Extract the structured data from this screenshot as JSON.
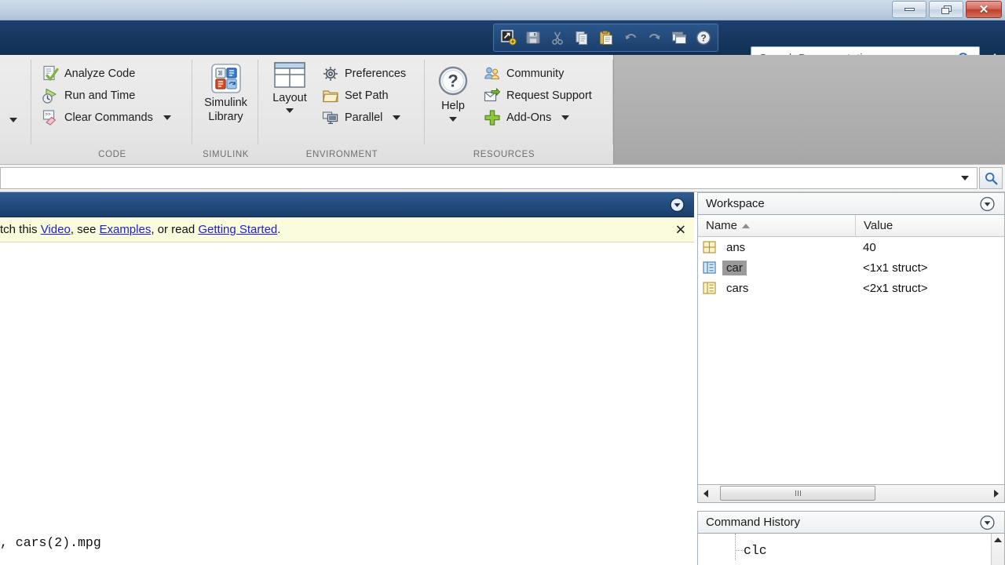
{
  "window": {
    "controls": [
      {
        "name": "minimize",
        "glyph": "minimize-icon"
      },
      {
        "name": "restore",
        "glyph": "restore-icon"
      },
      {
        "name": "close",
        "glyph": "close-icon",
        "label": "✕",
        "color": "#bf3f2c"
      }
    ]
  },
  "quick_access": {
    "buttons": [
      {
        "name": "new-script-icon",
        "tooltip": "New Script"
      },
      {
        "name": "save-icon",
        "tooltip": "Save"
      },
      {
        "name": "cut-icon",
        "tooltip": "Cut"
      },
      {
        "name": "copy-icon",
        "tooltip": "Copy"
      },
      {
        "name": "paste-icon",
        "tooltip": "Paste"
      },
      {
        "name": "undo-icon",
        "tooltip": "Undo"
      },
      {
        "name": "redo-icon",
        "tooltip": "Redo"
      },
      {
        "name": "switch-windows-icon",
        "tooltip": "Switch Windows"
      },
      {
        "name": "help-icon",
        "tooltip": "Help"
      }
    ]
  },
  "search": {
    "placeholder": "Search Documentation",
    "icon": "magnifier-icon"
  },
  "ribbon": {
    "groups": [
      {
        "title": "CODE",
        "items": [
          {
            "label": "Analyze Code",
            "icon": "analyze-code-icon",
            "has_dropdown": false
          },
          {
            "label": "Run and Time",
            "icon": "run-and-time-icon",
            "has_dropdown": false
          },
          {
            "label": "Clear Commands",
            "icon": "clear-commands-icon",
            "has_dropdown": true
          }
        ]
      },
      {
        "title": "SIMULINK",
        "items": [
          {
            "label": "Simulink\nLibrary",
            "label_line1": "Simulink",
            "label_line2": "Library",
            "icon": "simulink-library-icon",
            "has_dropdown": false
          }
        ]
      },
      {
        "title": "ENVIRONMENT",
        "items": [
          {
            "label": "Layout",
            "icon": "layout-icon",
            "has_dropdown": true
          },
          {
            "label": "Preferences",
            "icon": "preferences-icon",
            "has_dropdown": false
          },
          {
            "label": "Set Path",
            "icon": "set-path-icon",
            "has_dropdown": false
          },
          {
            "label": "Parallel",
            "icon": "parallel-icon",
            "has_dropdown": true
          }
        ]
      },
      {
        "title": "RESOURCES",
        "items": [
          {
            "label": "Help",
            "icon": "help-circle-icon",
            "has_dropdown": true
          },
          {
            "label": "Community",
            "icon": "community-icon",
            "has_dropdown": false
          },
          {
            "label": "Request Support",
            "icon": "request-support-icon",
            "has_dropdown": false
          },
          {
            "label": "Add-Ons",
            "icon": "add-ons-icon",
            "has_dropdown": true
          }
        ]
      }
    ]
  },
  "address_bar": {
    "value": "",
    "dropdown_icon": "chevron-down-icon",
    "browse_icon": "magnifier-icon"
  },
  "command_window": {
    "panel_dropdown_icon": "panel-menu-icon",
    "banner": {
      "prefix": "tch this ",
      "link1": "Video",
      "mid1": ", see ",
      "link2": "Examples",
      "mid2": ", or read ",
      "link3": "Getting Started",
      "suffix": ".",
      "close_label": "✕"
    },
    "lines": [
      ", cars(2).mpg"
    ]
  },
  "workspace": {
    "title": "Workspace",
    "panel_dropdown_icon": "panel-menu-icon",
    "columns": [
      "Name",
      "Value"
    ],
    "sorted_by": "Name",
    "rows": [
      {
        "name": "ans",
        "value": "40",
        "icon": "matrix-var-icon",
        "selected": false
      },
      {
        "name": "car",
        "value": "<1x1 struct>",
        "icon": "struct-var-blue-icon",
        "selected": true
      },
      {
        "name": "cars",
        "value": "<2x1 struct>",
        "icon": "struct-var-icon",
        "selected": false
      }
    ],
    "scrollbar": {
      "left_arrow_icon": "scroll-left-icon",
      "right_arrow_icon": "scroll-right-icon"
    }
  },
  "command_history": {
    "title": "Command History",
    "panel_dropdown_icon": "panel-menu-icon",
    "entries": [
      "clc"
    ],
    "scroll_up_icon": "scroll-up-icon"
  }
}
